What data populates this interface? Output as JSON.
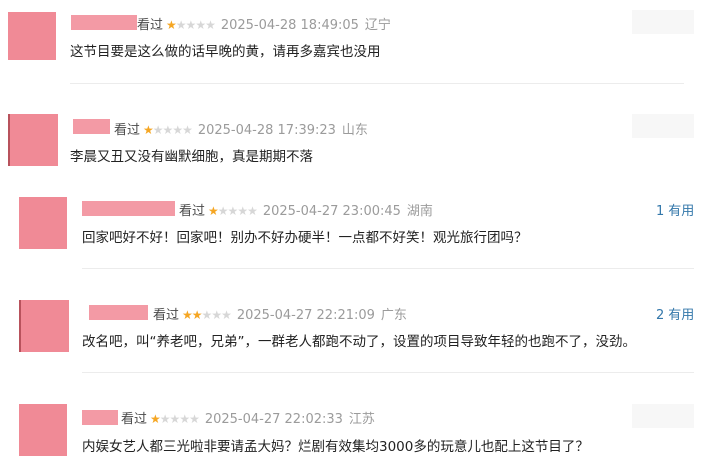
{
  "comments": [
    {
      "verb": "看过",
      "rating": 1,
      "time": "2025-04-28 18:49:05",
      "location": "辽宁",
      "text": "这节目要是这么做的话早晚的黄，请再多嘉宾也没用",
      "useful_count": "",
      "useful_label": ""
    },
    {
      "verb": "看过",
      "rating": 1,
      "time": "2025-04-28 17:39:23",
      "location": "山东",
      "text": "李晨又丑又没有幽默细胞，真是期期不落",
      "useful_count": "",
      "useful_label": ""
    },
    {
      "verb": "看过",
      "rating": 1,
      "time": "2025-04-27 23:00:45",
      "location": "湖南",
      "text": "回家吧好不好！回家吧！别办不好办硬半！一点都不好笑！观光旅行团吗？",
      "useful_count": "1",
      "useful_label": "有用"
    },
    {
      "verb": "看过",
      "rating": 2,
      "time": "2025-04-27 22:21:09",
      "location": "广东",
      "text": "改名吧，叫“养老吧，兄弟”，一群老人都跑不动了，设置的项目导致年轻的也跑不了，没劲。",
      "useful_count": "2",
      "useful_label": "有用"
    },
    {
      "verb": "看过",
      "rating": 1,
      "time": "2025-04-27 22:02:33",
      "location": "江苏",
      "text": "内娱女艺人都三光啦非要请孟大妈？烂剧有效集均3000多的玩意儿也配上这节目了？",
      "useful_count": "",
      "useful_label": ""
    }
  ],
  "colors": {
    "star_on": "#f5a623",
    "star_off": "#d7d7d7",
    "link": "#3377aa",
    "avatar_mask": "#f08a96"
  }
}
